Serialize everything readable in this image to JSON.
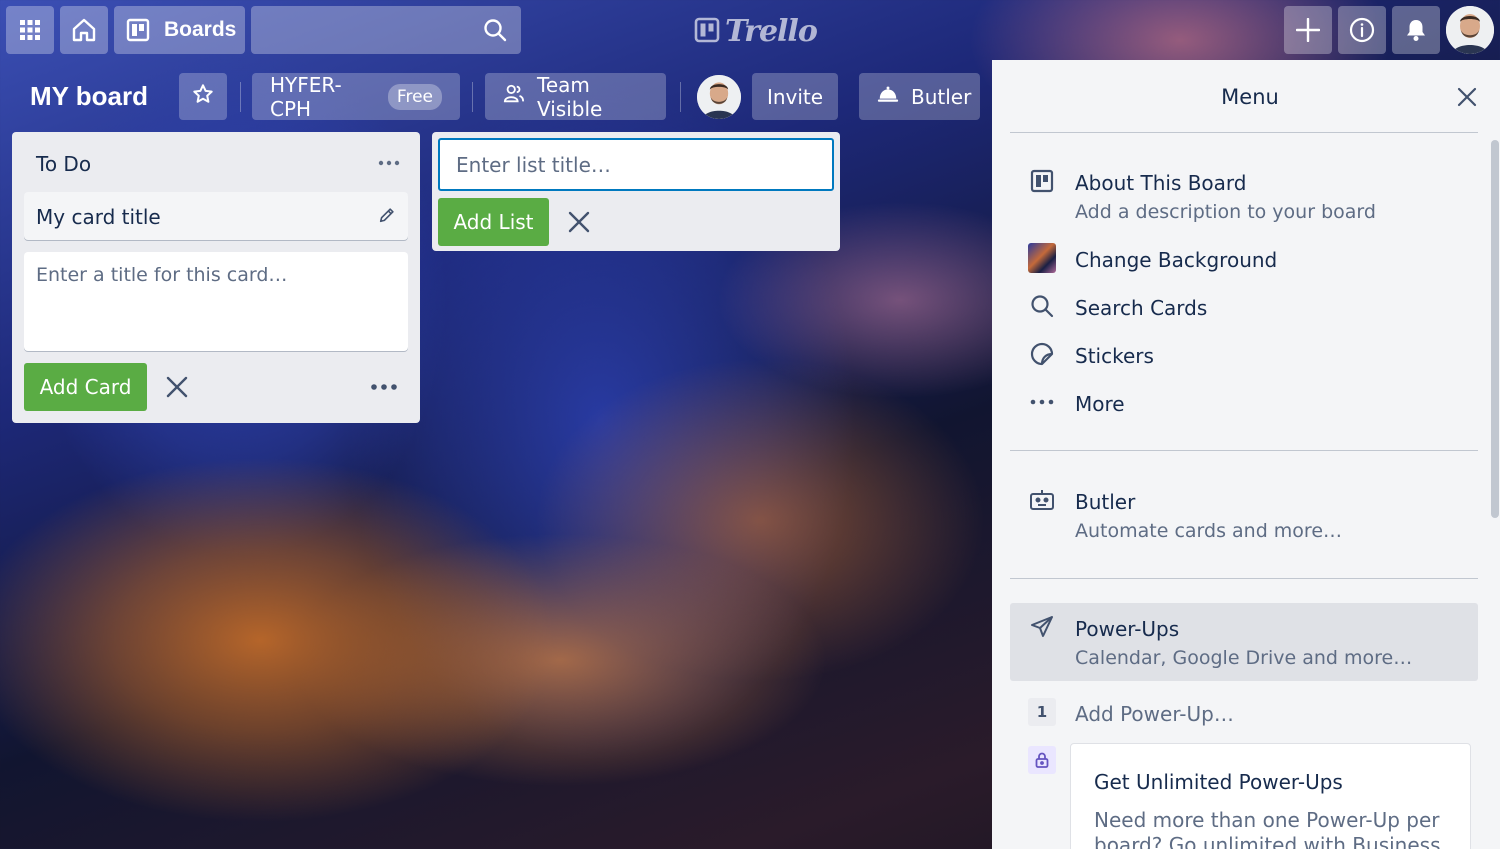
{
  "topbar": {
    "apps_icon": "apps-grid-icon",
    "home_icon": "home-icon",
    "boards_label": "Boards",
    "search_placeholder": "",
    "logo_text": "Trello",
    "create_icon": "plus-icon",
    "info_icon": "info-icon",
    "notifications_icon": "bell-icon"
  },
  "board": {
    "title": "MY board",
    "star_icon": "star-icon",
    "team_name": "HYFER-CPH",
    "team_badge": "Free",
    "visibility_label": "Team Visible",
    "invite_label": "Invite",
    "butler_label": "Butler"
  },
  "lists": [
    {
      "title": "To Do",
      "menu_icon": "more-icon",
      "cards": [
        {
          "title": "My card title"
        }
      ],
      "composer": {
        "placeholder": "Enter a title for this card…",
        "add_label": "Add Card"
      }
    }
  ],
  "add_list": {
    "placeholder": "Enter list title…",
    "add_label": "Add List"
  },
  "menu": {
    "title": "Menu",
    "items": [
      {
        "label": "About This Board",
        "sub": "Add a description to your board",
        "icon": "board-icon"
      },
      {
        "label": "Change Background",
        "icon": "background-thumbnail"
      },
      {
        "label": "Search Cards",
        "icon": "search-icon"
      },
      {
        "label": "Stickers",
        "icon": "sticker-icon"
      },
      {
        "label": "More",
        "icon": "more-icon"
      }
    ],
    "butler": {
      "label": "Butler",
      "sub": "Automate cards and more…",
      "icon": "robot-icon"
    },
    "powerups": {
      "label": "Power-Ups",
      "sub": "Calendar, Google Drive and more…",
      "icon": "rocket-icon"
    },
    "add_powerup": {
      "count": "1",
      "label": "Add Power-Up…"
    },
    "upsell": {
      "title": "Get Unlimited Power-Ups",
      "text": "Need more than one Power-Up per board? Go unlimited with Business"
    }
  },
  "colors": {
    "accent_green": "#5aac44",
    "focus_blue": "#0079bf",
    "list_bg": "#ebecf0",
    "menu_bg": "#f4f5f7"
  }
}
